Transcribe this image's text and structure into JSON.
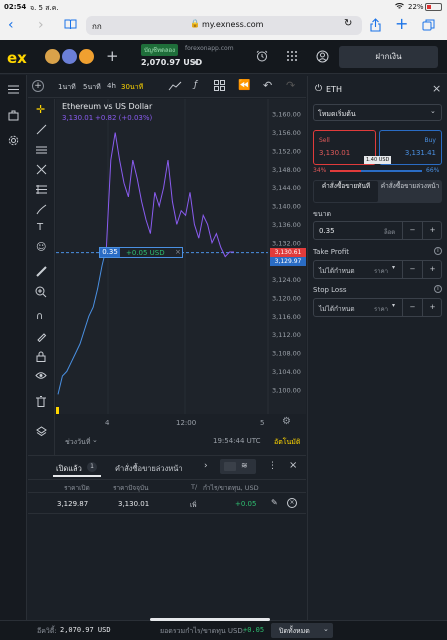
{
  "status": {
    "time": "02:54",
    "date": "จ. 5 ส.ค.",
    "battery": "22%"
  },
  "browser": {
    "tab_label": "กก",
    "url": "my.exness.com"
  },
  "header": {
    "logo": "ex",
    "account_type": "บัญชีทดลอง",
    "server": "forexonapp.com",
    "balance": "2,070.97 USD",
    "deposit_label": "ฝากเงิน"
  },
  "chart_toolbar": {
    "timeframes": [
      "1นาที",
      "5นาที",
      "4h",
      "30นาที"
    ],
    "active_timeframe": "30นาที"
  },
  "chart": {
    "title": "Ethereum vs US Dollar",
    "quote": "3,130.01",
    "change": "+0.82 (+0.03%)",
    "order_line_qty": "0.35",
    "order_line_pl": "+0.05 USD",
    "ask_tag": "3,130.61",
    "bid_tag": "3,129.97",
    "timestamp": "19:54:44 UTC",
    "auto_label": "อัตโนมัติ",
    "range_label": "ช่วงวันที่"
  },
  "chart_data": {
    "type": "line",
    "title": "Ethereum vs US Dollar",
    "x_ticks": [
      "4",
      "12:00",
      "5"
    ],
    "y_ticks": [
      "3,160.00",
      "3,156.00",
      "3,152.00",
      "3,148.00",
      "3,144.00",
      "3,140.00",
      "3,136.00",
      "3,132.00",
      "3,128.00",
      "3,124.00",
      "3,120.00",
      "3,116.00",
      "3,112.00",
      "3,108.00",
      "3,104.00",
      "3,100.00"
    ],
    "ylim": [
      3098,
      3162
    ],
    "series": [
      {
        "name": "",
        "color": "#4a90e2",
        "values": [
          3099,
          3103,
          3104,
          3106,
          3108,
          3110,
          3113,
          3116,
          3118,
          3122,
          3127,
          3131
        ]
      },
      {
        "name": "",
        "color": "#8a5cf0",
        "values": [
          3131,
          3150,
          3156,
          3150,
          3145,
          3142,
          3150,
          3146,
          3141,
          3137,
          3134,
          3143,
          3140,
          3144,
          3150,
          3141,
          3136,
          3139,
          3138,
          3143,
          3136,
          3133,
          3138,
          3136,
          3132,
          3134,
          3131,
          3129,
          3130,
          3130
        ]
      }
    ]
  },
  "panel": {
    "symbol": "ETH",
    "mode": "โหมดเริ่มต้น",
    "sell_label": "Sell",
    "sell_price": "3,130.01",
    "buy_label": "Buy",
    "buy_price": "3,131.41",
    "spread": "1.40 USD",
    "sell_pct": "34%",
    "buy_pct": "66%",
    "sell_pct_value": 34,
    "tab_market": "คำสั่งซื้อขายทันที",
    "tab_pending": "คำสั่งซื้อขายล่วงหน้า",
    "volume_label": "ขนาด",
    "volume_value": "0.35",
    "volume_unit": "ล็อต",
    "tp_label": "Take Profit",
    "tp_value": "ไม่ได้กำหนด",
    "tp_unit": "ราคา",
    "sl_label": "Stop Loss",
    "sl_value": "ไม่ได้กำหนด",
    "sl_unit": "ราคา"
  },
  "positions": {
    "tab_open": "เปิดแล้ว",
    "open_count": "1",
    "tab_pending": "คำสั่งซื้อขายล่วงหน้า",
    "col_open_price": "ราคาเปิด",
    "col_current_price": "ราคาปัจจุบัน",
    "col_tp": "T/",
    "col_pl": "กำไร/ขาดทุน, USD",
    "rows": [
      {
        "open_price": "3,129.87",
        "current_price": "3,130.01",
        "tp": "เพิ่",
        "pl": "+0.05"
      }
    ]
  },
  "footer": {
    "equity_label": "อีควิตี้:",
    "equity_value": "2,070.97 USD",
    "total_pl_label": "ยอดรวมกำไร/ขาดทุน USD:",
    "total_pl_value": "+0.05",
    "close_all": "ปิดทั้งหมด"
  }
}
